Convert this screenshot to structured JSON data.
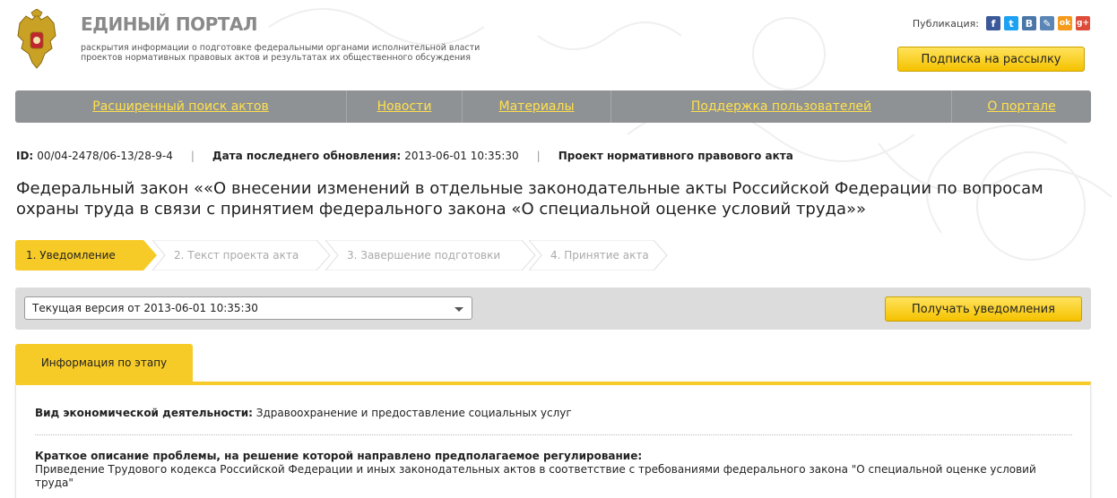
{
  "header": {
    "portal_title": "ЕДИНЫЙ ПОРТАЛ",
    "portal_subtitle_line1": "раскрытия информации о подготовке федеральными органами исполнительной власти",
    "portal_subtitle_line2": "проектов нормативных правовых актов и результатах их общественного обсуждения",
    "share_label": "Публикация:",
    "share_icons": [
      {
        "name": "facebook-icon",
        "glyph": "f",
        "color": "#3b5998"
      },
      {
        "name": "twitter-icon",
        "glyph": "t",
        "color": "#1da1f2"
      },
      {
        "name": "vk-icon",
        "glyph": "B",
        "color": "#4a76a8"
      },
      {
        "name": "livejournal-icon",
        "glyph": "✎",
        "color": "#5a85b5"
      },
      {
        "name": "odnoklassniki-icon",
        "glyph": "ok",
        "color": "#f59a1b"
      },
      {
        "name": "google-plus-icon",
        "glyph": "g+",
        "color": "#dd4b39"
      }
    ],
    "subscribe_label": "Подписка на рассылку"
  },
  "nav": {
    "items": [
      {
        "label": "Расширенный поиск актов"
      },
      {
        "label": "Новости"
      },
      {
        "label": "Материалы"
      },
      {
        "label": "Поддержка пользователей"
      },
      {
        "label": "О портале"
      }
    ]
  },
  "meta": {
    "id_label": "ID:",
    "id_value": "00/04-2478/06-13/28-9-4",
    "updated_label": "Дата последнего обновления:",
    "updated_value": "2013-06-01 10:35:30",
    "doc_type": "Проект нормативного правового акта"
  },
  "document": {
    "title": "Федеральный закон ««О внесении изменений в отдельные законодательные акты Российской Федерации по вопросам охраны труда в связи с принятием федерального закона «О специальной оценке условий труда»»"
  },
  "steps": [
    {
      "label": "1. Уведомление",
      "active": true
    },
    {
      "label": "2. Текст проекта акта",
      "active": false
    },
    {
      "label": "3. Завершение подготовки",
      "active": false
    },
    {
      "label": "4. Принятие акта",
      "active": false
    }
  ],
  "version": {
    "selected": "Текущая версия от 2013-06-01 10:35:30",
    "notify_label": "Получать уведомления"
  },
  "tab": {
    "label": "Информация по этапу"
  },
  "info": {
    "activity_label": "Вид экономической деятельности:",
    "activity_value": "Здравоохранение и предоставление социальных услуг",
    "problem_label": "Краткое описание проблемы, на решение которой направлено предполагаемое регулирование:",
    "problem_value": "Приведение Трудового кодекса Российской Федерации и иных законодательных актов в соответствие с требованиями федерального закона \"О специальной оценке условий труда\""
  },
  "colors": {
    "accent_yellow": "#f7cb27",
    "nav_gray": "#8f9294",
    "nav_link": "#ffe14d"
  }
}
